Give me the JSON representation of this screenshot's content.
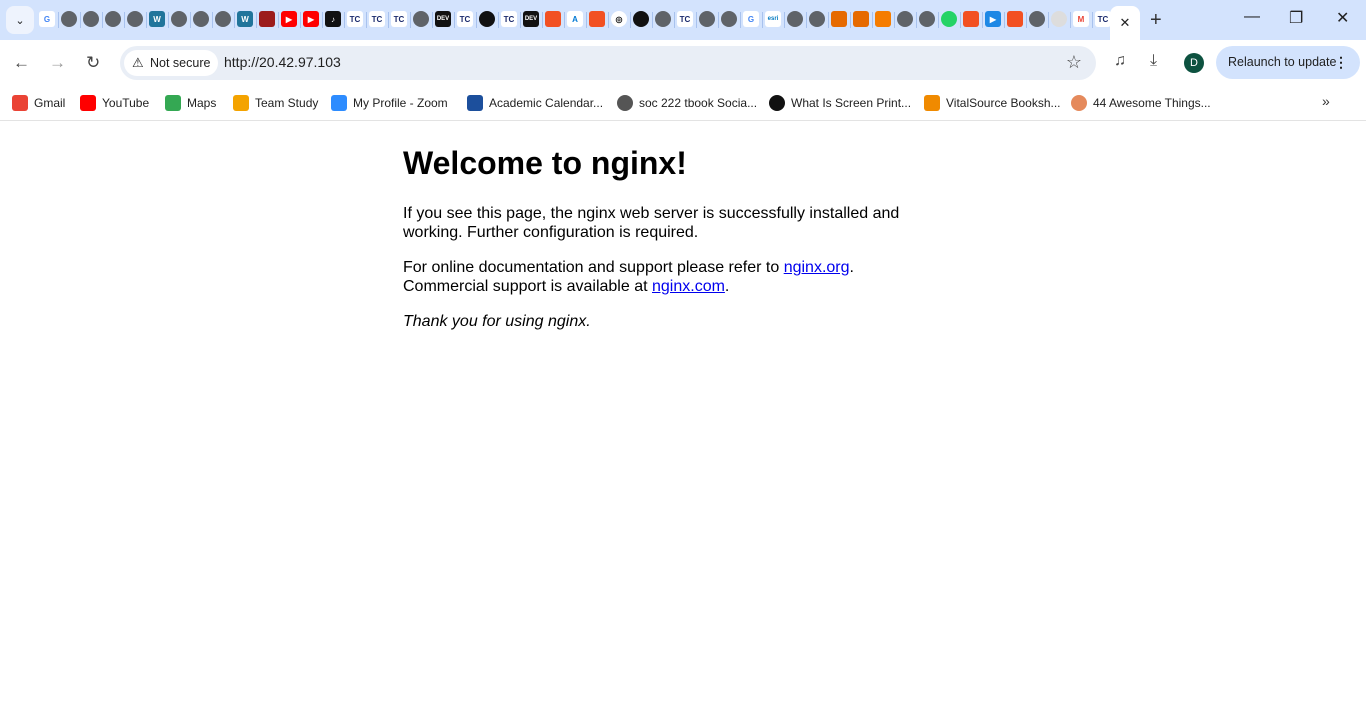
{
  "tabstrip": {
    "tab_icons": [
      "google",
      "globe",
      "globe",
      "globe",
      "globe",
      "wordpress",
      "globe",
      "globe",
      "globe",
      "wordpress",
      "beer",
      "youtube",
      "youtube",
      "tiktok",
      "tc",
      "tc",
      "tc",
      "globe",
      "dev",
      "tc",
      "github",
      "tc",
      "dev",
      "microsoft",
      "azure",
      "microsoft",
      "openai",
      "github",
      "globe",
      "tc",
      "globe",
      "globe",
      "google",
      "esri",
      "globe",
      "globe",
      "orange",
      "orange",
      "box",
      "globe",
      "globe",
      "whatsapp",
      "microsoft",
      "media",
      "microsoft",
      "globe",
      "dsi",
      "gmail",
      "tc"
    ],
    "active_tab_close": "✕",
    "new_tab": "+",
    "search_tabs": "⌄"
  },
  "window": {
    "minimize": "—",
    "restore": "❐",
    "close": "✕"
  },
  "toolbar": {
    "back": "←",
    "forward": "→",
    "reload": "↻",
    "security_label": "Not secure",
    "url": "http://20.42.97.103",
    "avatar_letter": "D",
    "relaunch_label": "Relaunch to update"
  },
  "bookmarks": [
    {
      "label": "Gmail",
      "icon": "gmail",
      "color": "#ea4335"
    },
    {
      "label": "YouTube",
      "icon": "youtube",
      "color": "#ff0000"
    },
    {
      "label": "Maps",
      "icon": "maps",
      "color": "#34a853"
    },
    {
      "label": "Team Study",
      "icon": "team-study",
      "color": "#f4a300"
    },
    {
      "label": "My Profile - Zoom",
      "icon": "zoom",
      "color": "#2d8cff"
    },
    {
      "label": "Academic Calendar...",
      "icon": "tree",
      "color": "#1c4f9c"
    },
    {
      "label": "soc 222 tbook Socia...",
      "icon": "globe",
      "color": "#555"
    },
    {
      "label": "What Is Screen Print...",
      "icon": "screen-print",
      "color": "#111"
    },
    {
      "label": "VitalSource Booksh...",
      "icon": "vitalsource",
      "color": "#f08a00"
    },
    {
      "label": "44 Awesome Things...",
      "icon": "flower",
      "color": "#e58a5c"
    }
  ],
  "page": {
    "title": "Welcome to nginx!",
    "p1": "If you see this page, the nginx web server is successfully installed and working. Further configuration is required.",
    "p2_pre": "For online documentation and support please refer to ",
    "link1": "nginx.org",
    "p2_mid": ".",
    "p2_line2": "Commercial support is available at ",
    "link2": "nginx.com",
    "p2_end": ".",
    "thanks": "Thank you for using nginx."
  }
}
